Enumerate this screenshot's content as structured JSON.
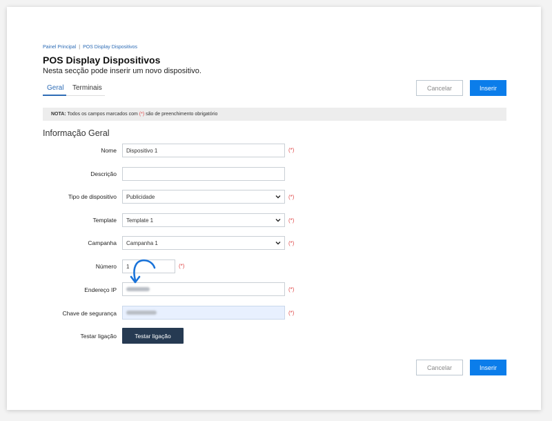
{
  "breadcrumb": {
    "items": [
      "Painel Principal",
      "POS Display Dispositivos"
    ],
    "separator": "|"
  },
  "page": {
    "title": "POS Display Dispositivos",
    "subtitle": "Nesta secção pode inserir um novo dispositivo."
  },
  "tabs": [
    {
      "label": "Geral",
      "active": true
    },
    {
      "label": "Terminais",
      "active": false
    }
  ],
  "actions": {
    "cancel_label": "Cancelar",
    "insert_label": "Inserir"
  },
  "note": {
    "prefix": "NOTA:",
    "text_before": "Todos os campos marcados com",
    "marker": "(*)",
    "text_after": "são de preenchimento obrigatório"
  },
  "section": {
    "title": "Informação Geral"
  },
  "form": {
    "required_marker": "(*)",
    "nome": {
      "label": "Nome",
      "value": "Dispositivo 1",
      "required": true
    },
    "descricao": {
      "label": "Descrição",
      "value": "",
      "required": false
    },
    "tipo": {
      "label": "Tipo de dispositivo",
      "selected": "Publicidade",
      "required": true
    },
    "template": {
      "label": "Template",
      "selected": "Template 1",
      "required": true
    },
    "campanha": {
      "label": "Campanha",
      "selected": "Campanha 1",
      "required": true
    },
    "numero": {
      "label": "Número",
      "value": "1",
      "required": true
    },
    "endereco_ip": {
      "label": "Endereço IP",
      "value_blurred": true,
      "required": true
    },
    "chave": {
      "label": "Chave de segurança",
      "value_blurred": true,
      "required": true
    },
    "testar": {
      "label": "Testar ligação",
      "button_label": "Testar ligação"
    }
  },
  "colors": {
    "accent": "#0b7dea",
    "link": "#2c6bb5",
    "required": "#e04a4a",
    "dark_button": "#263a52",
    "arrow": "#1a73d9"
  },
  "icons": {
    "select_chevron": "chevron-down-icon",
    "annotation": "curved-arrow-icon"
  }
}
